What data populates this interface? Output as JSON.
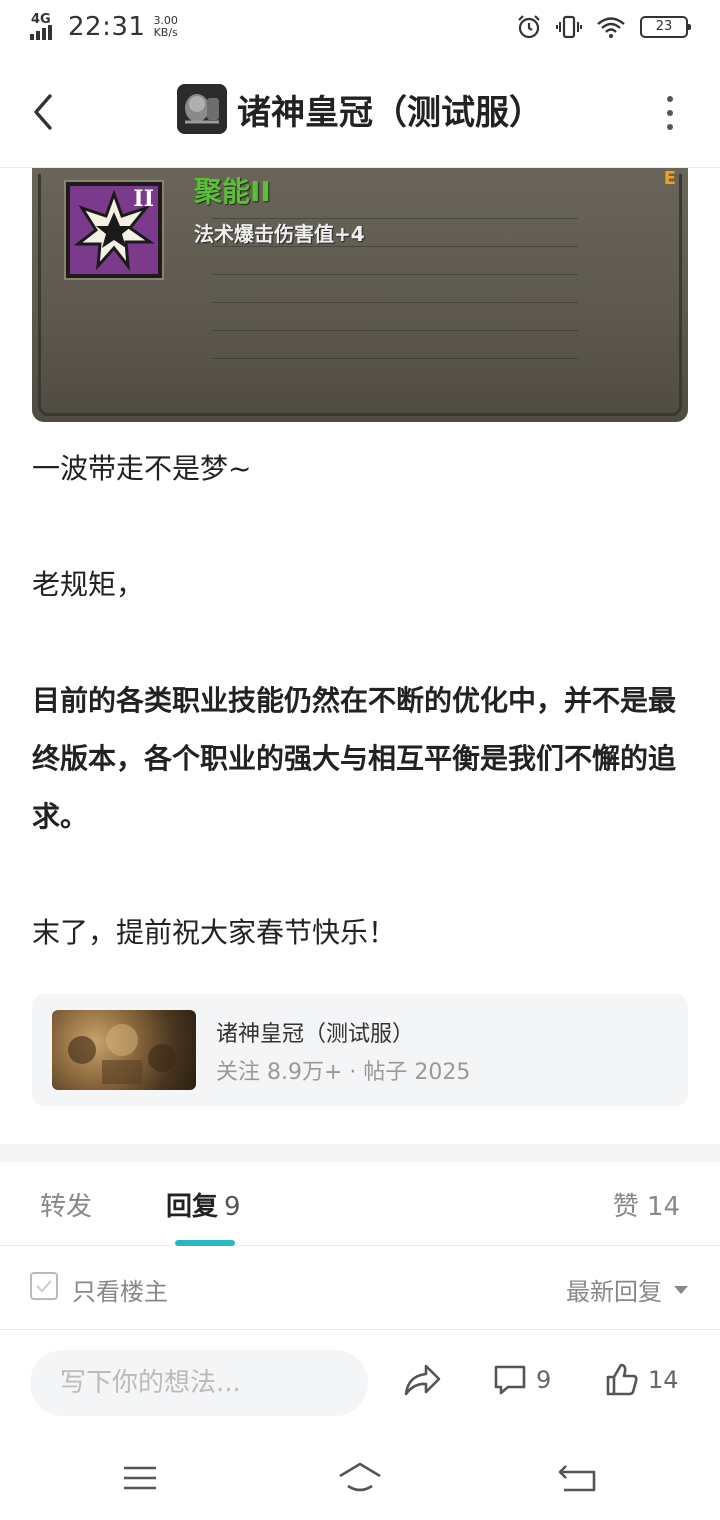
{
  "status_bar": {
    "network": "4G",
    "time": "22:31",
    "speed_value": "3.00",
    "speed_unit": "KB/s",
    "battery": "23"
  },
  "header": {
    "title": "诸神皇冠（测试服）",
    "back_icon": "chevron-left-icon",
    "more_icon": "more-vertical-icon"
  },
  "game_image": {
    "skill_name": "聚能II",
    "skill_roman": "II",
    "skill_desc": "法术爆击伤害值+4",
    "corner_letter": "E"
  },
  "post": {
    "paragraphs": [
      "一波带走不是梦~",
      "老规矩，",
      "目前的各类职业技能仍然在不断的优化中，并不是最终版本，各个职业的强大与相互平衡是我们不懈的追求。",
      "末了，提前祝大家春节快乐！"
    ]
  },
  "forum_card": {
    "name": "诸神皇冠（测试服）",
    "meta": "关注 8.9万+ · 帖子 2025"
  },
  "tabs": {
    "forward": "转发",
    "reply": "回复",
    "reply_count": "9",
    "like": "赞",
    "like_count": "14"
  },
  "filter": {
    "only_host": "只看楼主",
    "sort": "最新回复"
  },
  "action_bar": {
    "input_placeholder": "写下你的想法...",
    "comment_count": "9",
    "like_count": "14"
  },
  "colors": {
    "accent": "#29b6c8",
    "text": "#222222",
    "muted": "#888888"
  }
}
